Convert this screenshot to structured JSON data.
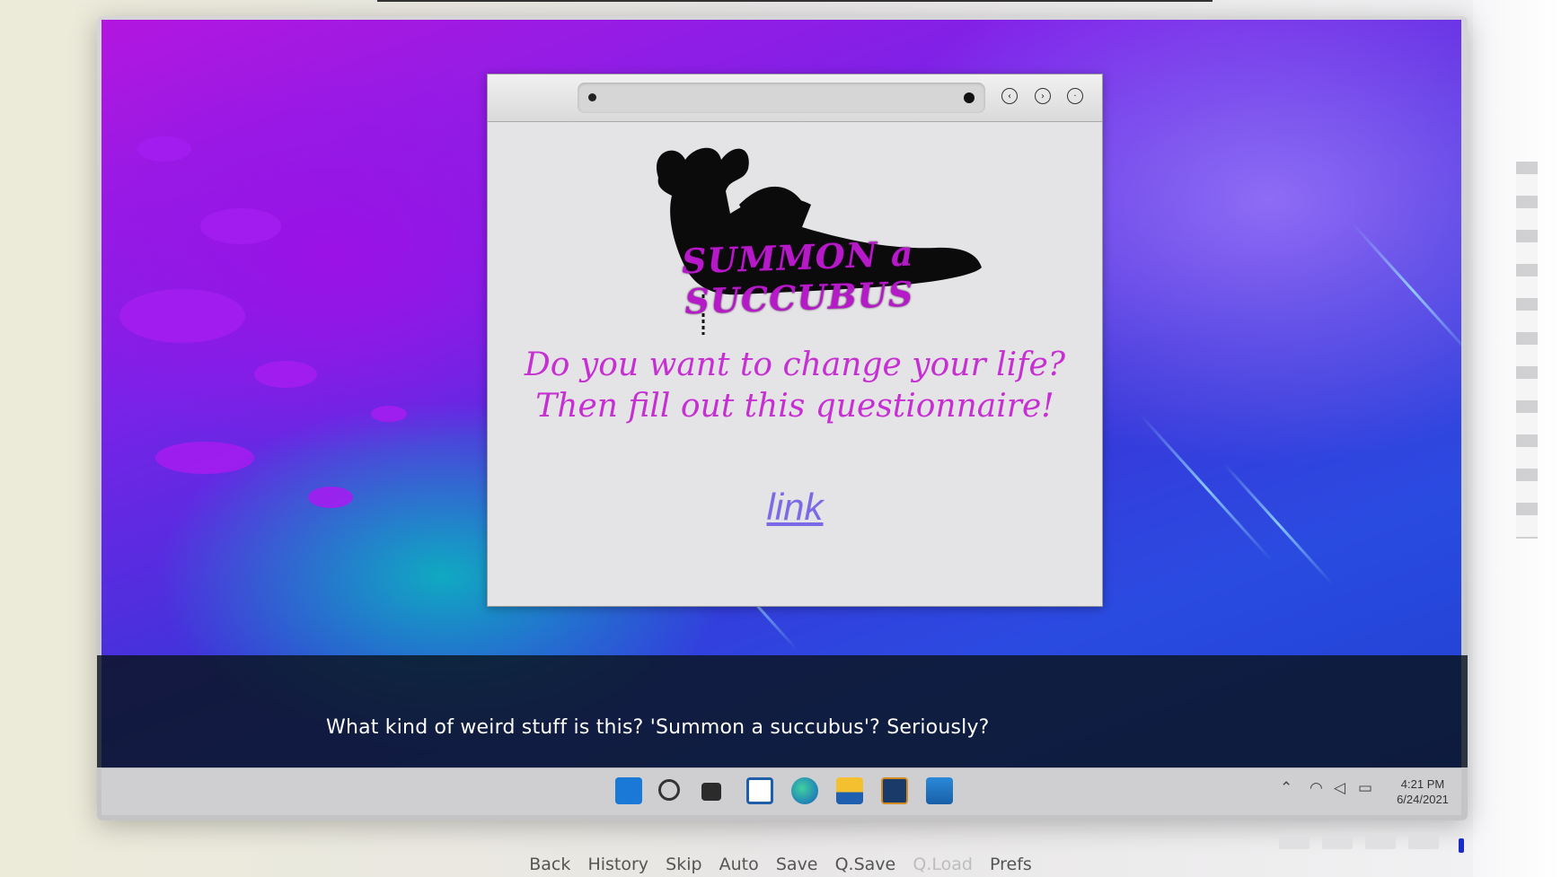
{
  "browser": {
    "nav_buttons": [
      "back-icon",
      "forward-icon",
      "close-icon"
    ],
    "page": {
      "logo_text": "SUMMON a SUCCUBUS",
      "tagline_line1": "Do you want to change your life?",
      "tagline_line2": "Then fill out this questionnaire!",
      "link_text": "link"
    }
  },
  "dialogue": {
    "text": "What kind of weird stuff is this? 'Summon a succubus'? Seriously?"
  },
  "taskbar": {
    "icons": [
      "windows-start-icon",
      "search-icon",
      "task-view-icon",
      "widgets-icon",
      "edge-browser-icon",
      "file-explorer-icon",
      "store-icon",
      "mail-icon"
    ],
    "tray_icons": [
      "chevron-up-icon",
      "wifi-icon",
      "volume-icon",
      "battery-icon"
    ],
    "time": "4:21 PM",
    "date": "6/24/2021"
  },
  "quick_menu": [
    {
      "label": "Back",
      "enabled": true
    },
    {
      "label": "History",
      "enabled": true
    },
    {
      "label": "Skip",
      "enabled": true
    },
    {
      "label": "Auto",
      "enabled": true
    },
    {
      "label": "Save",
      "enabled": true
    },
    {
      "label": "Q.Save",
      "enabled": true
    },
    {
      "label": "Q.Load",
      "enabled": false
    },
    {
      "label": "Prefs",
      "enabled": true
    }
  ],
  "colors": {
    "logo": "#b619c8",
    "tagline": "#c62fd2",
    "link": "#7a6ae6",
    "dialogue_bg": "#0a141e"
  }
}
